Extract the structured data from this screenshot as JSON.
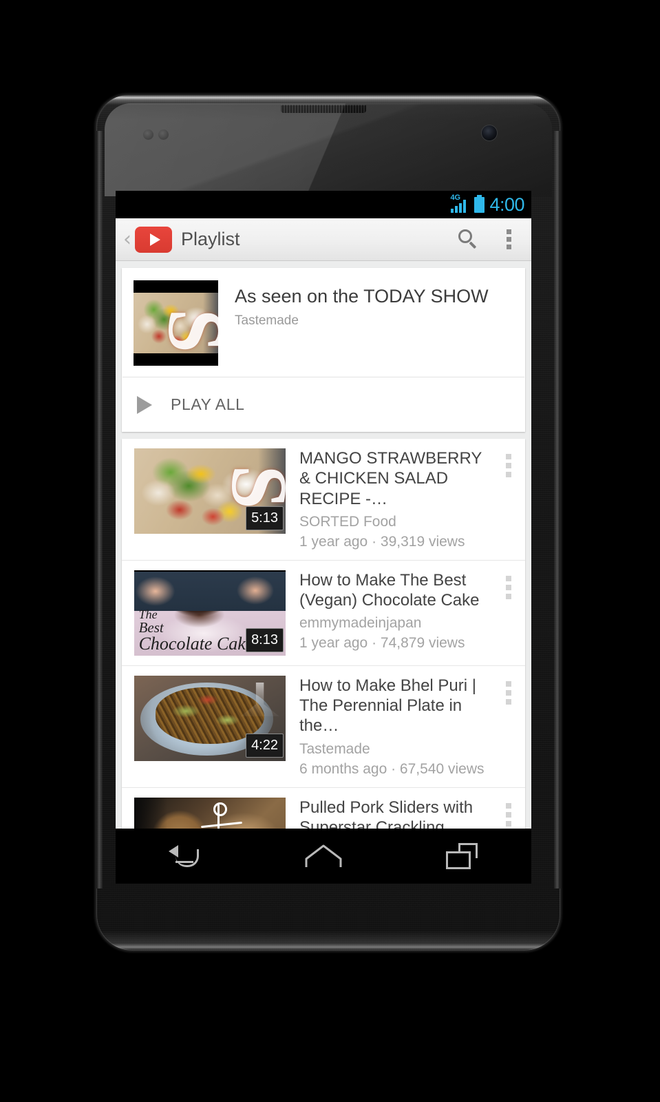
{
  "device": {
    "name": "android-phone",
    "status_bar": {
      "network_type": "4G",
      "signal_icon": "signal-bars-icon",
      "battery_icon": "battery-full-icon",
      "time": "4:00",
      "accent_color": "#2fb8ea"
    },
    "nav_bar": {
      "back": "back-icon",
      "home": "home-icon",
      "recents": "recents-icon"
    }
  },
  "app": {
    "name": "YouTube",
    "brand_color": "#d93b31",
    "action_bar": {
      "up_chevron": "‹",
      "logo": "youtube-logo-icon",
      "title": "Playlist",
      "search": "search-icon",
      "overflow": "overflow-menu-icon"
    }
  },
  "playlist_header": {
    "thumbnail": "playlist-thumbnail",
    "title": "As seen on the TODAY SHOW",
    "author": "Tastemade",
    "play_all_label": "PLAY ALL",
    "play_icon": "play-icon"
  },
  "videos": [
    {
      "thumbnail": "video-thumbnail-salad",
      "duration": "5:13",
      "title": "MANGO STRAWBERRY & CHICKEN SALAD RECIPE -…",
      "channel": "SORTED Food",
      "stats": "1 year ago · 39,319 views",
      "overflow": "overflow-menu-icon"
    },
    {
      "thumbnail": "video-thumbnail-chocolate-cake",
      "duration": "8:13",
      "title": "How to Make The Best (Vegan) Chocolate Cake",
      "channel": "emmymadeinjapan",
      "stats": "1 year ago · 74,879 views",
      "overflow": "overflow-menu-icon"
    },
    {
      "thumbnail": "video-thumbnail-bhel-puri",
      "duration": "4:22",
      "title": "How to Make Bhel Puri | The Perennial Plate in the…",
      "channel": "Tastemade",
      "stats": "6 months ago · 67,540 views",
      "overflow": "overflow-menu-icon"
    },
    {
      "thumbnail": "video-thumbnail-pulled-pork",
      "duration": "",
      "title": "Pulled Pork Sliders with Superstar Crackling",
      "channel": "",
      "stats": "",
      "overflow": "overflow-menu-icon"
    }
  ],
  "thumbnail_text": {
    "salad_letter": "S",
    "cake_line1": "The",
    "cake_line2": "Best",
    "cake_line3": "Chocolate Cake"
  }
}
